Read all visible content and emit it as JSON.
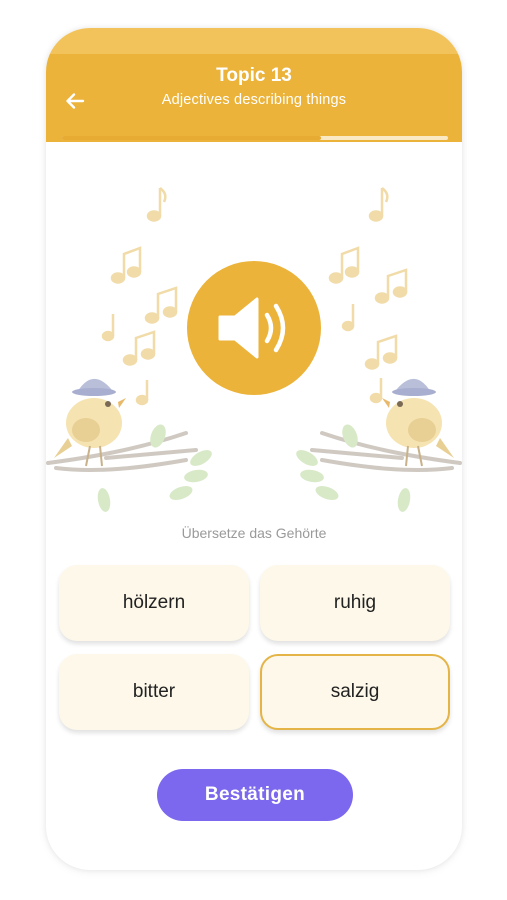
{
  "header": {
    "title": "Topic 13",
    "subtitle": "Adjectives describing things",
    "back_icon": "arrow-left-icon"
  },
  "progress": {
    "fraction": 0.67
  },
  "audio": {
    "icon": "speaker-volume-icon"
  },
  "prompt": "Übersetze das Gehörte",
  "options": [
    {
      "label": "hölzern",
      "selected": false
    },
    {
      "label": "ruhig",
      "selected": false
    },
    {
      "label": "bitter",
      "selected": false
    },
    {
      "label": "salzig",
      "selected": true
    }
  ],
  "confirm_label": "Bestätigen",
  "colors": {
    "header": "#ebb33a",
    "accent": "#e7ab33",
    "option_bg": "#fdf8e9",
    "selected_border": "#e4b447",
    "confirm_bg": "#7b68ee"
  }
}
